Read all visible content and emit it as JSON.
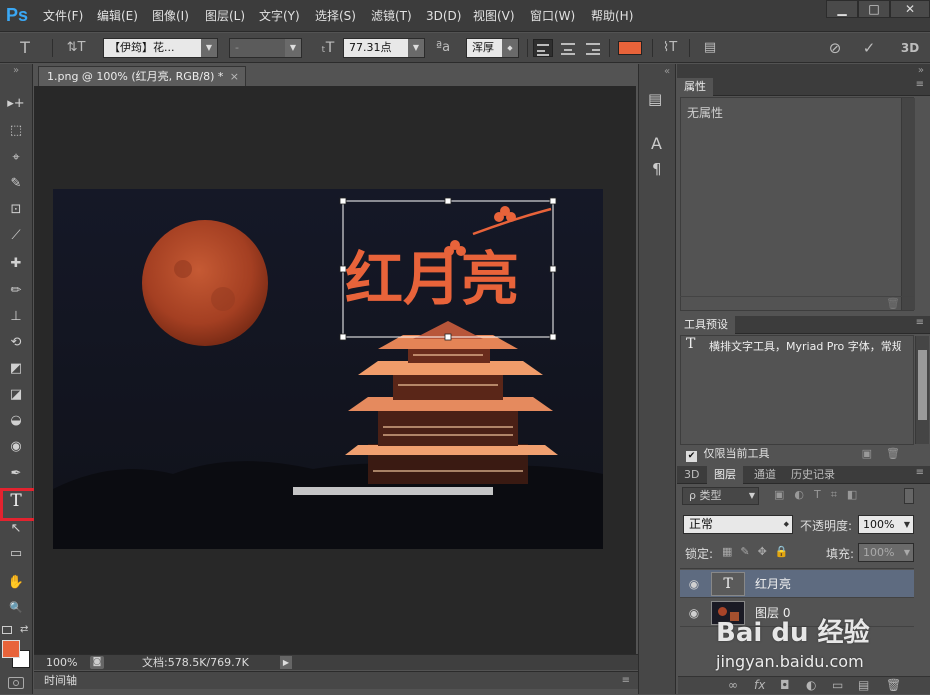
{
  "app": {
    "logo": "Ps"
  },
  "menu": [
    "文件(F)",
    "编辑(E)",
    "图像(I)",
    "图层(L)",
    "文字(Y)",
    "选择(S)",
    "滤镜(T)",
    "3D(D)",
    "视图(V)",
    "窗口(W)",
    "帮助(H)"
  ],
  "window_controls": [
    "▁",
    "□",
    "✕"
  ],
  "options": {
    "tool_glyph": "T",
    "orient_glyph": "⇅T",
    "font_family": "【伊筠】花...",
    "font_style": "-",
    "size_glyph": "ₜT",
    "font_size": "77.31点",
    "aa_glyph": "ªa",
    "antialias": "浑厚",
    "text_color": "#e8633a",
    "warp_glyph": "⌇T",
    "panel_glyph": "▤",
    "cancel_glyph": "⊘",
    "commit_glyph": "✓",
    "threeD": "3D"
  },
  "tools": [
    "▸+",
    "⬚",
    "⌖",
    "✎",
    "⊡",
    "⟋",
    "✚",
    "✏",
    "⊥",
    "⟲",
    "◩",
    "◪",
    "◒",
    "◉",
    "✒",
    "T",
    "↖",
    "▭",
    "✋",
    "🔍"
  ],
  "document": {
    "tab_title": "1.png @ 100% (红月亮, RGB/8) *",
    "tab_close": "×",
    "canvas_text": "红月亮",
    "zoom": "100%",
    "doc_size": "文档:578.5K/769.7K",
    "timeline_label": "时间轴"
  },
  "colors": {
    "foreground": "#e8633a",
    "background": "#ffffff",
    "highlight": "#e3232f",
    "moon": "#b8492a",
    "sky": "#141622"
  },
  "icon_strip": [
    "▤",
    "A",
    "¶"
  ],
  "properties": {
    "title": "属性",
    "body": "无属性"
  },
  "tool_presets": {
    "title": "工具预设",
    "item_glyph": "T",
    "item": "横排文字工具，Myriad Pro 字体，常规",
    "checkbox_label": "仅限当前工具",
    "checked": "✔"
  },
  "layers_panel": {
    "tabs": [
      "3D",
      "图层",
      "通道",
      "历史记录"
    ],
    "filter_label": "ρ 类型",
    "blend_mode": "正常",
    "opacity_label": "不透明度:",
    "opacity": "100%",
    "lock_label": "锁定:",
    "fill_label": "填充:",
    "fill": "100%",
    "layers": [
      {
        "name": "红月亮",
        "type": "text",
        "thumb_glyph": "T",
        "visible_glyph": "◉"
      },
      {
        "name": "图层 0",
        "type": "image",
        "thumb_glyph": "",
        "visible_glyph": "◉"
      }
    ],
    "bottom_icons": [
      "∞",
      "fx",
      "◘",
      "◐",
      "▭",
      "▤",
      "🗑"
    ]
  },
  "watermark": {
    "brand": "Bai du 经验",
    "url": "jingyan.baidu.com"
  }
}
